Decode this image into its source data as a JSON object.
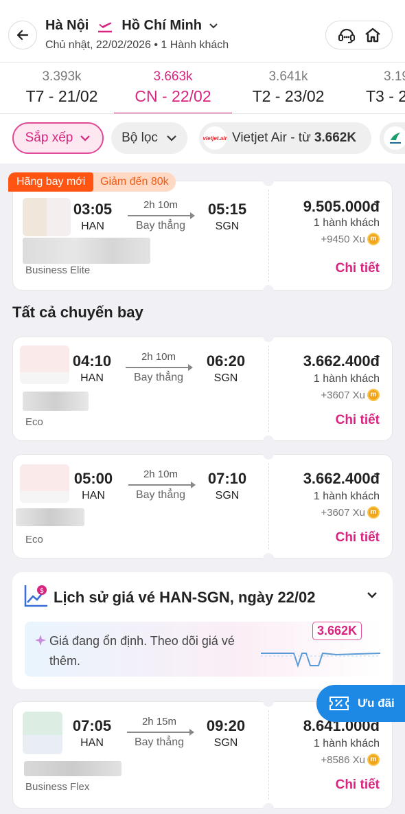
{
  "header": {
    "origin": "Hà Nội",
    "destination": "Hồ Chí Minh",
    "subtitle": "Chủ nhật, 22/02/2026 • 1 Hành khách"
  },
  "dates": [
    {
      "price": "3.393k",
      "label": "T7 - 21/02",
      "active": false
    },
    {
      "price": "3.663k",
      "label": "CN - 22/02",
      "active": true
    },
    {
      "price": "3.641k",
      "label": "T2 - 23/02",
      "active": false
    },
    {
      "price": "3.19",
      "label": "T3 - 2",
      "active": false
    }
  ],
  "filters": {
    "sort_label": "Sắp xếp",
    "filter_label": "Bộ lọc",
    "airline_label": "Vietjet Air - từ",
    "airline_price": "3.662K",
    "airline_logo_text": "vietjet.air"
  },
  "badges": {
    "new_airline": "Hãng bay mới",
    "discount": "Giảm đến 80k"
  },
  "section_title": "Tất cả chuyến bay",
  "flights": [
    {
      "dep_time": "03:05",
      "dep_code": "HAN",
      "arr_time": "05:15",
      "arr_code": "SGN",
      "duration": "2h 10m",
      "stops": "Bay thẳng",
      "fare_class": "Business Elite",
      "price": "9.505.000đ",
      "pax": "1 hành khách",
      "xu": "+9450 Xu",
      "detail": "Chi tiết"
    },
    {
      "dep_time": "04:10",
      "dep_code": "HAN",
      "arr_time": "06:20",
      "arr_code": "SGN",
      "duration": "2h 10m",
      "stops": "Bay thẳng",
      "fare_class": "Eco",
      "price": "3.662.400đ",
      "pax": "1 hành khách",
      "xu": "+3607 Xu",
      "detail": "Chi tiết"
    },
    {
      "dep_time": "05:00",
      "dep_code": "HAN",
      "arr_time": "07:10",
      "arr_code": "SGN",
      "duration": "2h 10m",
      "stops": "Bay thẳng",
      "fare_class": "Eco",
      "price": "3.662.400đ",
      "pax": "1 hành khách",
      "xu": "+3607 Xu",
      "detail": "Chi tiết"
    },
    {
      "dep_time": "07:05",
      "dep_code": "HAN",
      "arr_time": "09:20",
      "arr_code": "SGN",
      "duration": "2h 15m",
      "stops": "Bay thẳng",
      "fare_class": "Business Flex",
      "price": "8.641.000đ",
      "pax": "1 hành khách",
      "xu": "+8586 Xu",
      "detail": "Chi tiết"
    }
  ],
  "price_history": {
    "title": "Lịch sử giá vé HAN-SGN, ngày 22/02",
    "message": "Giá đang ổn định. Theo dõi giá vé thêm.",
    "current_price": "3.662K"
  },
  "promo_button": "Ưu đãi",
  "colors": {
    "accent": "#d8247f",
    "promo": "#1e88e5",
    "badge": "#ff5412"
  }
}
